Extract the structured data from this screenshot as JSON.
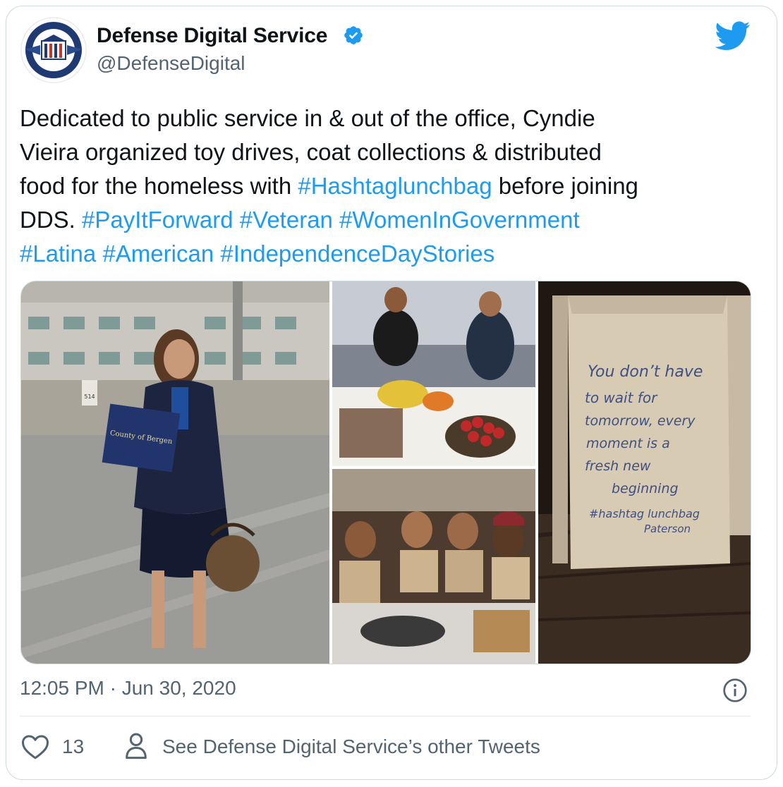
{
  "tweet": {
    "author_name": "Defense Digital Service",
    "author_handle": "@DefenseDigital",
    "logo_text_top": "DEPARTMENT OF DEFENSE",
    "logo_text_bottom": "DEFENSE DIGITAL SERVICE",
    "text_lines": [
      [
        {
          "t": "Dedicated to public service in & out of the office, Cyndie",
          "tag": false
        }
      ],
      [
        {
          "t": "Vieira organized toy drives, coat collections & distributed",
          "tag": false
        }
      ],
      [
        {
          "t": "food for the homeless with ",
          "tag": false
        },
        {
          "t": "#Hashtaglunchbag",
          "tag": true
        },
        {
          "t": " before joining",
          "tag": false
        }
      ],
      [
        {
          "t": "DDS. ",
          "tag": false
        },
        {
          "t": "#PayItForward",
          "tag": true
        },
        {
          "t": " ",
          "tag": false
        },
        {
          "t": "#Veteran",
          "tag": true
        },
        {
          "t": " ",
          "tag": false
        },
        {
          "t": "#WomenInGovernment",
          "tag": true
        }
      ],
      [
        {
          "t": "#Latina",
          "tag": true
        },
        {
          "t": " ",
          "tag": false
        },
        {
          "t": "#American",
          "tag": true
        },
        {
          "t": " ",
          "tag": false
        },
        {
          "t": "#IndependenceDayStories",
          "tag": true
        }
      ]
    ],
    "timestamp": "12:05 PM · Jun 30, 2020",
    "like_count": "13",
    "other_tweets_label": "See Defense Digital Service’s other Tweets"
  },
  "media": {
    "bag_note_lines": [
      "You don’t have",
      "to wait for",
      "tomorrow, every",
      "moment is a",
      "fresh new",
      "beginning",
      "#hashtag lunchbag",
      "Paterson"
    ],
    "certificate_text": "County of Bergen",
    "parking_sign_text": "514"
  },
  "icons": {
    "verified": "verified-badge-icon",
    "bird": "twitter-bird-icon",
    "info": "info-icon",
    "like": "heart-icon",
    "person": "person-icon"
  },
  "colors": {
    "link": "#1d9bf0",
    "secondary_text": "#536471",
    "border": "#cfd9de",
    "primary_text": "#0f1419"
  }
}
